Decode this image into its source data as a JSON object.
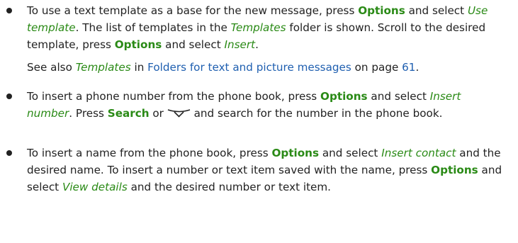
{
  "bullets": [
    {
      "t1": "To use a text template as a base for the new message, press ",
      "k1": "Options",
      "t2": " and select ",
      "k2": "Use template",
      "t3": ". The list of templates in the ",
      "k3": "Templates",
      "t4": " folder is shown. Scroll to the desired template, press ",
      "k4": "Options",
      "t5": " and select ",
      "k5": "Insert",
      "t6": "."
    },
    {
      "t1": "To insert a phone number from the phone book, press ",
      "k1": "Options",
      "t2": " and select ",
      "k2": "Insert number",
      "t3": ". Press ",
      "k3": "Search",
      "t4": " or ",
      "icon": "scroll-down-key-icon",
      "t5": " and search for the number in the phone book."
    },
    {
      "t1": "To insert a name from the phone book, press ",
      "k1": "Options",
      "t2": " and select ",
      "k2": "Insert contact",
      "t3": " and the desired name. To insert a number or text item saved with the name, press ",
      "k3": "Options",
      "t4": " and select ",
      "k4": "View details",
      "t5": " and the desired number or text item."
    }
  ],
  "see_also": {
    "t1": "See also ",
    "k1": "Templates",
    "t2": " in ",
    "link": "Folders for text and picture messages",
    "t3": " on page ",
    "page": "61",
    "t4": "."
  },
  "colors": {
    "key": "#2a8a16",
    "link": "#1f5fb0",
    "text": "#222222"
  }
}
